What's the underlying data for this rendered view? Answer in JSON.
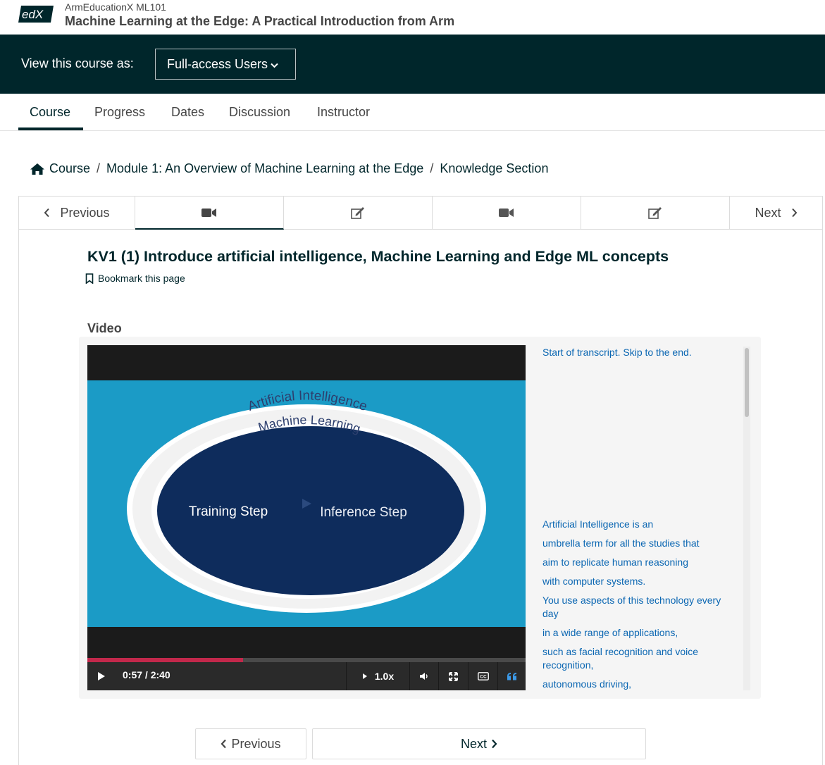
{
  "header": {
    "logo_text": "edX",
    "org": "ArmEducationX ML101",
    "course_title": "Machine Learning at the Edge: A Practical Introduction from Arm"
  },
  "banner": {
    "label": "View this course as:",
    "selected_role": "Full-access Users"
  },
  "tabs": [
    {
      "label": "Course",
      "active": true
    },
    {
      "label": "Progress"
    },
    {
      "label": "Dates"
    },
    {
      "label": "Discussion"
    },
    {
      "label": "Instructor"
    }
  ],
  "breadcrumb": {
    "home_icon": "home-icon",
    "items": [
      "Course",
      "Module 1: An Overview of Machine Learning at the Edge",
      "Knowledge Section"
    ],
    "separator": "/"
  },
  "sequence_nav": {
    "previous_label": "Previous",
    "next_label": "Next",
    "units": [
      {
        "icon": "video-icon",
        "active": true
      },
      {
        "icon": "edit-icon"
      },
      {
        "icon": "video-icon"
      },
      {
        "icon": "edit-icon"
      }
    ]
  },
  "unit": {
    "title": "KV1 (1) Introduce artificial intelligence, Machine Learning and Edge ML concepts",
    "bookmark_label": "Bookmark this page",
    "video_heading": "Video"
  },
  "video": {
    "frame_text": {
      "outer": "Artificial Intelligence",
      "middle": "Machine Learning",
      "left": "Training Step",
      "right": "Inference Step"
    },
    "time": "0:57 / 2:40",
    "progress": 0.356,
    "speed": "1.0x",
    "accent_color": "#c2284b"
  },
  "transcript": {
    "skip_text": "Start of transcript. Skip to the end.",
    "lines": [
      "Artificial Intelligence is an",
      "umbrella term for all the studies that",
      "aim to replicate human reasoning",
      "with computer systems.",
      "You use aspects of this technology every day",
      "in a wide range of applications,",
      "such as facial recognition and voice recognition,",
      "autonomous driving,"
    ]
  },
  "bottom_nav": {
    "previous_label": "Previous",
    "next_label": "Next"
  }
}
